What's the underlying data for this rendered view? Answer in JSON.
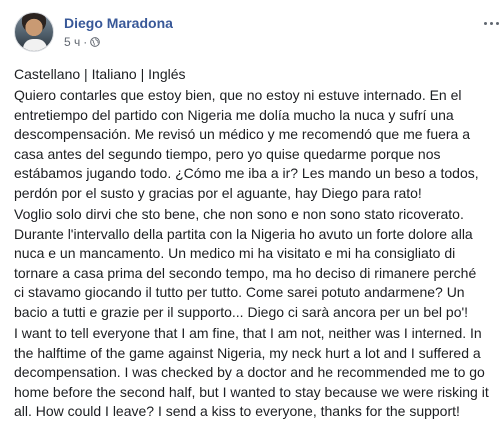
{
  "post": {
    "author": "Diego Maradona",
    "time": "5 ч",
    "separator": "·",
    "privacy_icon": "globe-icon",
    "more_icon": "more-options-icon",
    "languages": {
      "castellano": "Castellano",
      "italiano": "Italiano",
      "ingles": "Inglés",
      "divider": "|"
    },
    "paragraphs": [
      "Quiero contarles que estoy bien, que no estoy ni estuve internado. En el\nentretiempo del partido con Nigeria me dolía mucho la nuca y sufrí una\ndescompensación. Me revisó un médico y me recomendó que me fuera a\ncasa antes del segundo tiempo, pero yo quise quedarme porque nos\nestábamos jugando todo. ¿Cómo me iba a ir? Les mando un beso a todos,\nperdón por el susto y gracias por el aguante, hay Diego para rato!",
      "Voglio solo dirvi che sto bene, che non sono e non sono stato ricoverato.\nDurante l'intervallo della partita con la Nigeria ho avuto un forte dolore alla\nnuca e un mancamento. Un medico mi ha visitato e mi ha consigliato di\ntornare a casa prima del secondo tempo, ma ho deciso di rimanere perché\nci stavamo giocando il tutto per tutto. Come sarei potuto andarmene? Un\nbacio a tutti e grazie per il supporto... Diego ci sarà ancora per un bel po'!",
      "I want to tell everyone that I am fine, that I am not, neither was I interned. In\nthe halftime of the game against Nigeria, my neck hurt a lot and I suffered a\ndecompensation. I was checked by a doctor and he recommended me to go\nhome before the second half, but I wanted to stay because we were risking it\nall. How could I leave? I send a kiss to everyone, thanks for the support!"
    ]
  },
  "colors": {
    "author_link": "#385898",
    "text": "#1c1e21",
    "meta": "#616770"
  }
}
